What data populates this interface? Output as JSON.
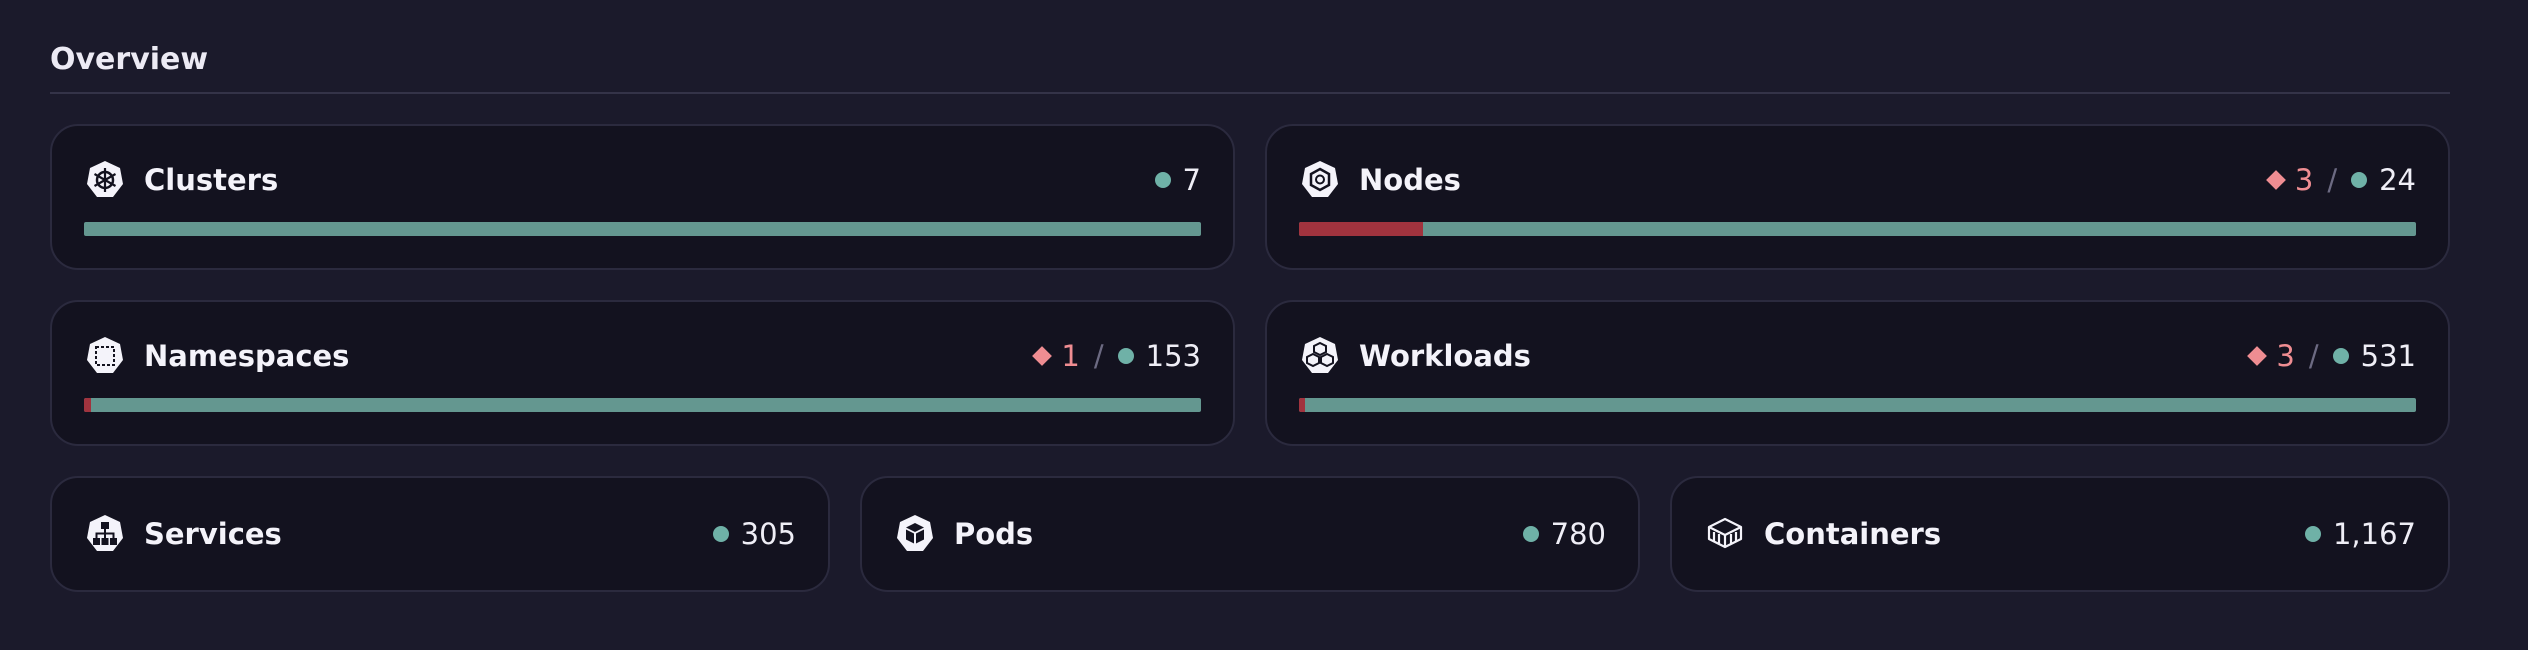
{
  "overview": {
    "title": "Overview",
    "colors": {
      "healthy": "#6fb1a7",
      "warning": "#ef8d92",
      "bar_healthy": "#649790",
      "bar_warning": "#a1333e"
    },
    "cards": {
      "clusters": {
        "title": "Clusters",
        "icon": "kubernetes-helm-icon",
        "healthy": "7"
      },
      "nodes": {
        "title": "Nodes",
        "icon": "node-icon",
        "warning": "3",
        "healthy": "24",
        "warning_fraction": 0.111
      },
      "namespaces": {
        "title": "Namespaces",
        "icon": "namespace-icon",
        "warning": "1",
        "healthy": "153",
        "warning_fraction": 0.0065
      },
      "workloads": {
        "title": "Workloads",
        "icon": "workload-icon",
        "warning": "3",
        "healthy": "531",
        "warning_fraction": 0.0056
      },
      "services": {
        "title": "Services",
        "icon": "service-icon",
        "healthy": "305"
      },
      "pods": {
        "title": "Pods",
        "icon": "pod-icon",
        "healthy": "780"
      },
      "containers": {
        "title": "Containers",
        "icon": "container-icon",
        "healthy": "1,167"
      }
    }
  }
}
